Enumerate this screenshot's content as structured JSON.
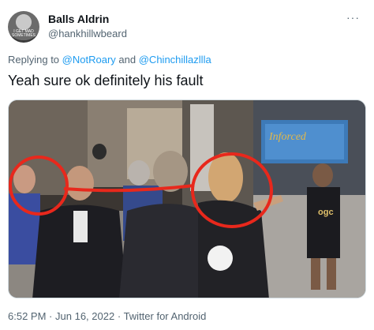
{
  "author": {
    "display_name": "Balls Aldrin",
    "handle": "@hankhillwbeard",
    "avatar_caption": "I GET MAD SOMETIMES"
  },
  "reply": {
    "prefix": "Replying to",
    "mention_1": "@NotRoary",
    "connector": "and",
    "mention_2": "@Chinchillazllla"
  },
  "tweet": {
    "text": "Yeah sure ok definitely his fault"
  },
  "media": {
    "sign_text": "Inforced",
    "shirt_text": "ogc",
    "annotation_color": "#e8281c"
  },
  "meta": {
    "time": "6:52 PM",
    "separator": "·",
    "date": "Jun 16, 2022",
    "source": "Twitter for Android"
  }
}
